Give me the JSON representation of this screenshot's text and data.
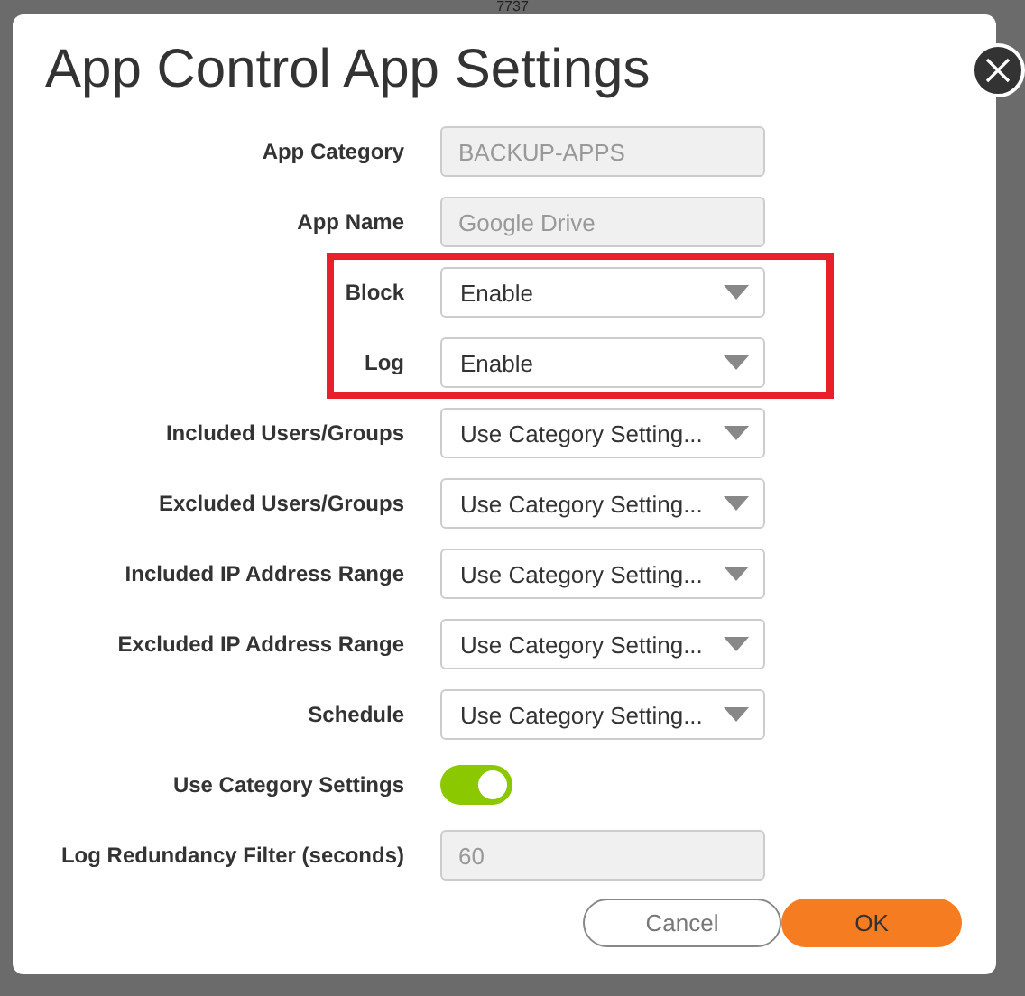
{
  "backdrop": {
    "text": "7737"
  },
  "dialog": {
    "title": "App Control App Settings"
  },
  "fields": [
    {
      "label": "App Category",
      "kind": "text",
      "value": "BACKUP-APPS",
      "disabled": true,
      "highlighted": false
    },
    {
      "label": "App Name",
      "kind": "text",
      "value": "Google Drive",
      "disabled": true,
      "highlighted": false
    },
    {
      "label": "Block",
      "kind": "select",
      "value": "Enable",
      "highlighted": true
    },
    {
      "label": "Log",
      "kind": "select",
      "value": "Enable",
      "highlighted": true
    },
    {
      "label": "Included Users/Groups",
      "kind": "select",
      "value": "Use Category Setting...",
      "highlighted": false
    },
    {
      "label": "Excluded Users/Groups",
      "kind": "select",
      "value": "Use Category Setting...",
      "highlighted": false
    },
    {
      "label": "Included IP Address Range",
      "kind": "select",
      "value": "Use Category Setting...",
      "highlighted": false
    },
    {
      "label": "Excluded IP Address Range",
      "kind": "select",
      "value": "Use Category Setting...",
      "highlighted": false
    },
    {
      "label": "Schedule",
      "kind": "select",
      "value": "Use Category Setting...",
      "highlighted": false
    },
    {
      "label": "Use Category Settings",
      "kind": "toggle",
      "on": true,
      "highlighted": false
    },
    {
      "label": "Log Redundancy Filter (seconds)",
      "kind": "text",
      "value": "60",
      "disabled": true,
      "highlighted": false
    }
  ],
  "buttons": [
    {
      "label": "Cancel",
      "kind": "secondary"
    },
    {
      "label": "OK",
      "kind": "primary"
    }
  ]
}
